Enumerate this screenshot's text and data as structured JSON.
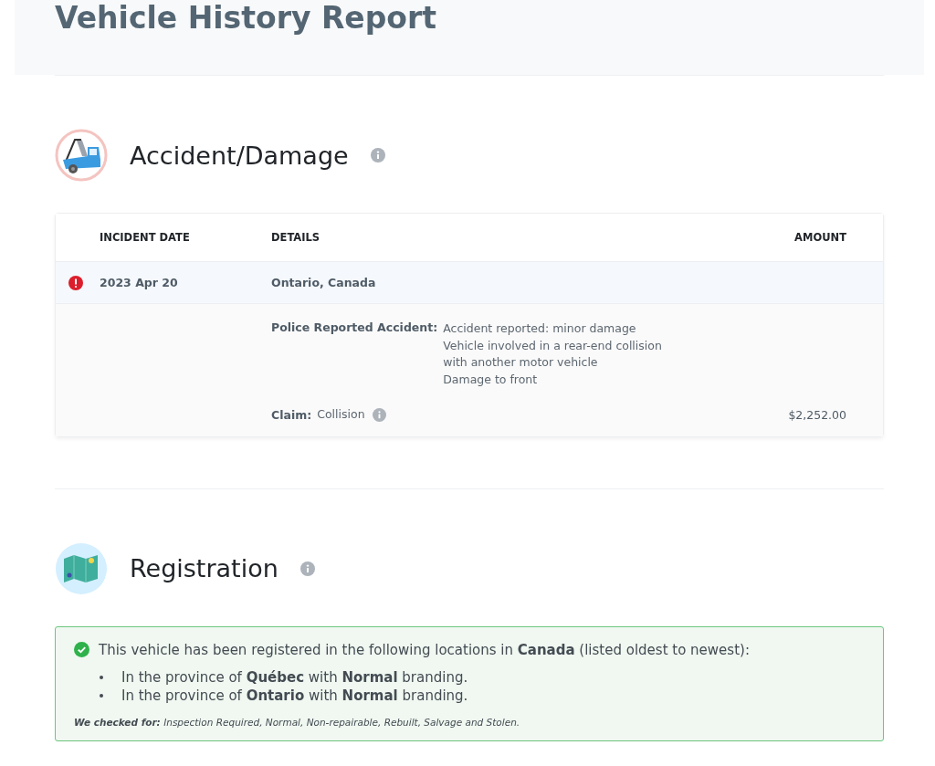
{
  "page_title": "Vehicle History Report",
  "accident": {
    "title": "Accident/Damage",
    "info": true,
    "columns": [
      "INCIDENT DATE",
      "DETAILS",
      "AMOUNT"
    ],
    "incidents": [
      {
        "alert": true,
        "date": "2023 Apr 20",
        "location": "Ontario, Canada",
        "details": [
          {
            "label": "Police Reported Accident:",
            "lines": [
              "Accident reported: minor damage",
              "Vehicle involved in a rear-end collision",
              "with another motor vehicle",
              "Damage to front"
            ],
            "info": false
          },
          {
            "label": "Claim:",
            "lines": [
              "Collision"
            ],
            "info": true,
            "amount": "$2,252.00"
          }
        ]
      }
    ]
  },
  "registration": {
    "title": "Registration",
    "info": true,
    "kind": "success",
    "summary": "This vehicle has been registered in the following locations in **Canada** (listed oldest to newest):",
    "locations": [
      "In the province of **Québec** with **Normal** branding.",
      "In the province of **Ontario** with **Normal** branding."
    ],
    "checked_for": "**We checked for:** Inspection Required, Normal, Non-repairable, Rebuilt, Salvage and Stolen."
  }
}
